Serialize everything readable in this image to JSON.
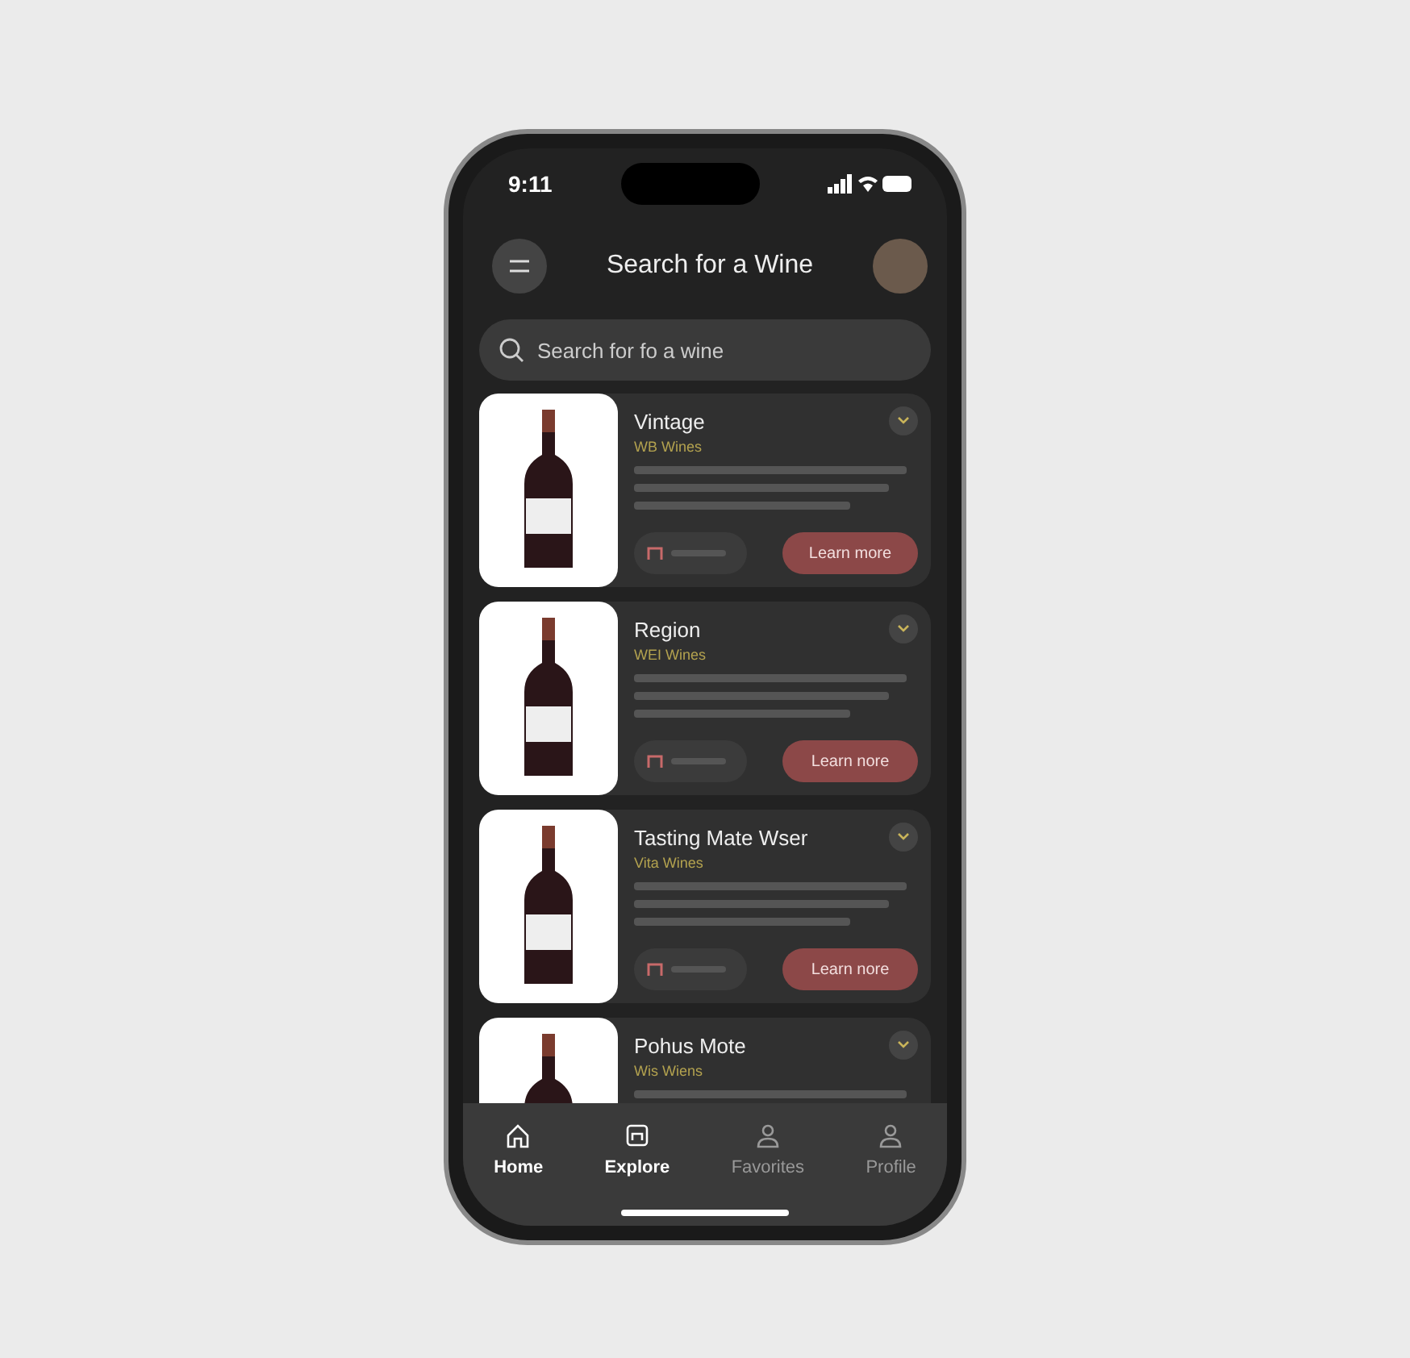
{
  "status_bar": {
    "time": "9:11"
  },
  "header": {
    "title": "Search for a Wine"
  },
  "search": {
    "placeholder": "Search for fo a wine"
  },
  "wines": [
    {
      "title": "Vintage",
      "subtitle": "WB Wines",
      "action": "Learn more"
    },
    {
      "title": "Region",
      "subtitle": "WEI Wines",
      "action": "Learn nore"
    },
    {
      "title": "Tasting Mate Wser",
      "subtitle": "Vita Wines",
      "action": "Learn nore"
    },
    {
      "title": "Pohus Mote",
      "subtitle": "Wis Wiens"
    }
  ],
  "nav": [
    {
      "label": "Home",
      "kind": "home",
      "active": true
    },
    {
      "label": "Explore",
      "kind": "explore",
      "active": true
    },
    {
      "label": "Favorites",
      "kind": "person",
      "active": false
    },
    {
      "label": "Profile",
      "kind": "person",
      "active": false
    }
  ]
}
